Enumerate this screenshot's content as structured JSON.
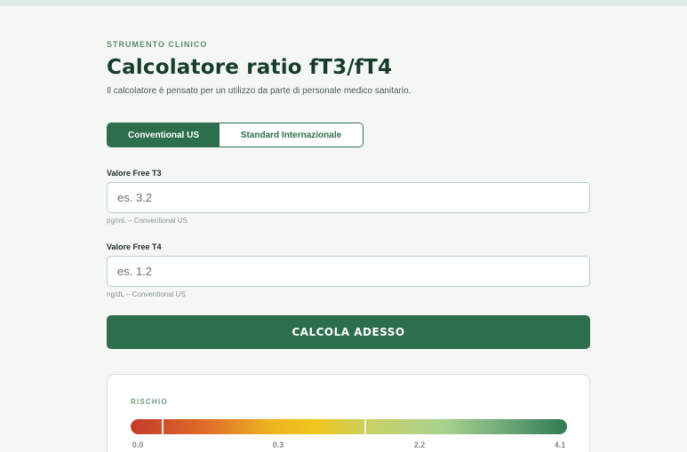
{
  "header": {
    "eyebrow": "STRUMENTO CLINICO",
    "title": "Calcolatore ratio fT3/fT4",
    "subtitle": "Il calcolatore è pensato per un utilizzo da parte di personale medico sanitario."
  },
  "unit_toggle": {
    "options": [
      "Conventional US",
      "Standard Internazionale"
    ],
    "selected": "Conventional US"
  },
  "fields": {
    "ft3": {
      "label": "Valore Free T3",
      "placeholder": "es. 3.2",
      "value": "",
      "hint": "pg/mL – Conventional US"
    },
    "ft4": {
      "label": "Valore Free T4",
      "placeholder": "es. 1.2",
      "value": "",
      "hint": "ng/dL – Conventional US"
    }
  },
  "actions": {
    "calculate_label": "CALCOLA ADESSO"
  },
  "risk": {
    "heading": "RISCHIO",
    "ticks": [
      "0.0",
      "0.3",
      "2.2",
      "4.1"
    ]
  },
  "colors": {
    "accent": "#2d6e4c",
    "background": "#f4f7f4",
    "gradient": [
      "#c43b2b",
      "#e0702a",
      "#f0c61c",
      "#a7d18e",
      "#2f7a52"
    ]
  }
}
